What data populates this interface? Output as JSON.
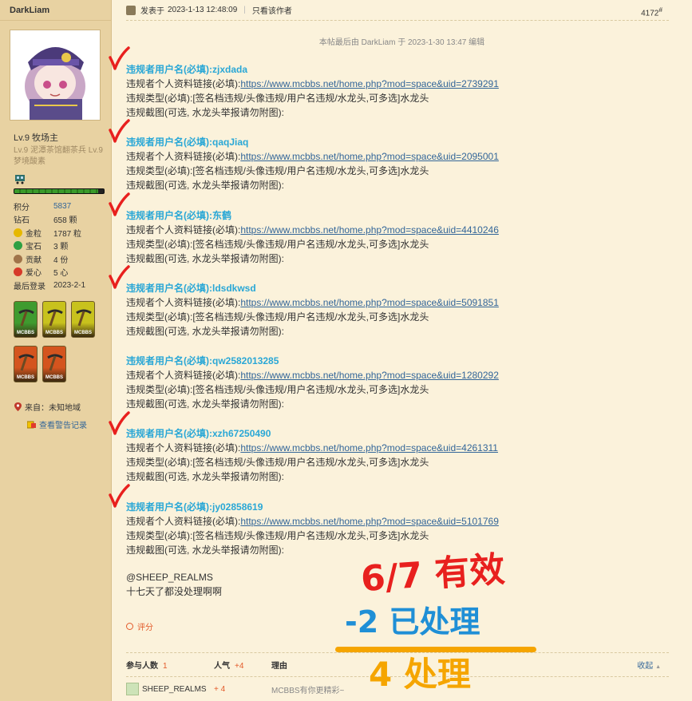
{
  "sidebar": {
    "username": "DarkLiam",
    "level_main": "Lv.9 牧场主",
    "level_sub": "Lv.9 泥潭茶馆翻茶兵 Lv.9 梦境酸素",
    "xp_progress": 0.94,
    "stats": [
      {
        "label": "积分",
        "value": "5837",
        "link": true,
        "icon": ""
      },
      {
        "label": "钻石",
        "value": "658 颗",
        "link": false,
        "icon": ""
      },
      {
        "label": "金粒",
        "value": "1787 粒",
        "link": false,
        "icon": "gold-icon"
      },
      {
        "label": "宝石",
        "value": "3 颗",
        "link": false,
        "icon": "gem-icon"
      },
      {
        "label": "贡献",
        "value": "4 份",
        "link": false,
        "icon": "contribution-icon"
      },
      {
        "label": "爱心",
        "value": "5 心",
        "link": false,
        "icon": "heart-icon"
      },
      {
        "label": "最后登录",
        "value": "2023-2-1",
        "link": false,
        "icon": ""
      }
    ],
    "medals": [
      {
        "name": "medal-badge",
        "label": "MCBBS",
        "color": "#3f9b2f"
      },
      {
        "name": "medal-badge",
        "label": "MCBBS",
        "color": "#c8c21d"
      },
      {
        "name": "medal-badge",
        "label": "MCBBS",
        "color": "#c8c21d"
      },
      {
        "name": "medal-badge",
        "label": "MCBBS",
        "color": "#d4541e"
      },
      {
        "name": "medal-badge",
        "label": "MCBBS",
        "color": "#d4541e"
      }
    ],
    "from_label": "来自：未知地域",
    "warn_label": "查看警告记录"
  },
  "post": {
    "posted_prefix": "发表于",
    "posted_time": "2023-1-13 12:48:09",
    "only_author": "只看该作者",
    "floor": "4172",
    "floor_mark": "#",
    "edit_note": "本帖最后由 DarkLiam 于 2023-1-30 13:47 编辑",
    "entries": [
      {
        "username": "违规者用户名(必填):zjxdada",
        "profile_label": "违规者个人资料链接(必填):",
        "profile_url": "https://www.mcbbs.net/home.php?mod=space&uid=2739291",
        "type_line": "违规类型(必填):[签名档违规/头像违规/用户名违规/水龙头,可多选]水龙头",
        "screenshot_line": "违规截图(可选, 水龙头举报请勿附图):",
        "checked": true
      },
      {
        "username": "违规者用户名(必填):qaqJiaq",
        "profile_label": "违规者个人资料链接(必填):",
        "profile_url": "https://www.mcbbs.net/home.php?mod=space&uid=2095001",
        "type_line": "违规类型(必填):[签名档违规/头像违规/用户名违规/水龙头,可多选]水龙头",
        "screenshot_line": "违规截图(可选, 水龙头举报请勿附图):",
        "checked": true
      },
      {
        "username": "违规者用户名(必填):东鹤",
        "profile_label": "违规者个人资料链接(必填):",
        "profile_url": "https://www.mcbbs.net/home.php?mod=space&uid=4410246",
        "type_line": "违规类型(必填):[签名档违规/头像违规/用户名违规/水龙头,可多选]水龙头",
        "screenshot_line": "违规截图(可选, 水龙头举报请勿附图):",
        "checked": true
      },
      {
        "username": "违规者用户名(必填):ldsdkwsd",
        "profile_label": "违规者个人资料链接(必填):",
        "profile_url": "https://www.mcbbs.net/home.php?mod=space&uid=5091851",
        "type_line": "违规类型(必填):[签名档违规/头像违规/用户名违规/水龙头,可多选]水龙头",
        "screenshot_line": "违规截图(可选, 水龙头举报请勿附图):",
        "checked": true
      },
      {
        "username": "违规者用户名(必填):qw2582013285",
        "profile_label": "违规者个人资料链接(必填):",
        "profile_url": "https://www.mcbbs.net/home.php?mod=space&uid=1280292",
        "type_line": "违规类型(必填):[签名档违规/头像违规/用户名违规/水龙头,可多选]水龙头",
        "screenshot_line": "违规截图(可选, 水龙头举报请勿附图):",
        "checked": false
      },
      {
        "username": "违规者用户名(必填):xzh67250490",
        "profile_label": "违规者个人资料链接(必填):",
        "profile_url": "https://www.mcbbs.net/home.php?mod=space&uid=4261311",
        "type_line": "违规类型(必填):[签名档违规/头像违规/用户名违规/水龙头,可多选]水龙头",
        "screenshot_line": "违规截图(可选, 水龙头举报请勿附图):",
        "checked": true
      },
      {
        "username": "违规者用户名(必填):jy02858619",
        "profile_label": "违规者个人资料链接(必填):",
        "profile_url": "https://www.mcbbs.net/home.php?mod=space&uid=5101769",
        "type_line": "违规类型(必填):[签名档违规/头像违规/用户名违规/水龙头,可多选]水龙头",
        "screenshot_line": "违规截图(可选, 水龙头举报请勿附图):",
        "checked": true
      }
    ],
    "mention": "@SHEEP_REALMS",
    "comment": "十七天了都没处理啊啊",
    "rate_label": "评分",
    "rate_table": {
      "participants_label": "参与人数",
      "participants_count": "1",
      "popularity_label": "人气",
      "popularity_value": "+4",
      "reason_label": "理由",
      "collapse_label": "收起",
      "rows": [
        {
          "user": "SHEEP_REALMS",
          "points": "+ 4",
          "reason": "MCBBS有你更精彩~"
        }
      ]
    }
  },
  "annotation": {
    "line1": "6/7 有效",
    "line2": "-2 已处理",
    "line3": "4 处理",
    "colors": {
      "red": "#e8201e",
      "blue": "#1f8fd6",
      "orange": "#f5a500",
      "check": "#e8201e"
    }
  }
}
